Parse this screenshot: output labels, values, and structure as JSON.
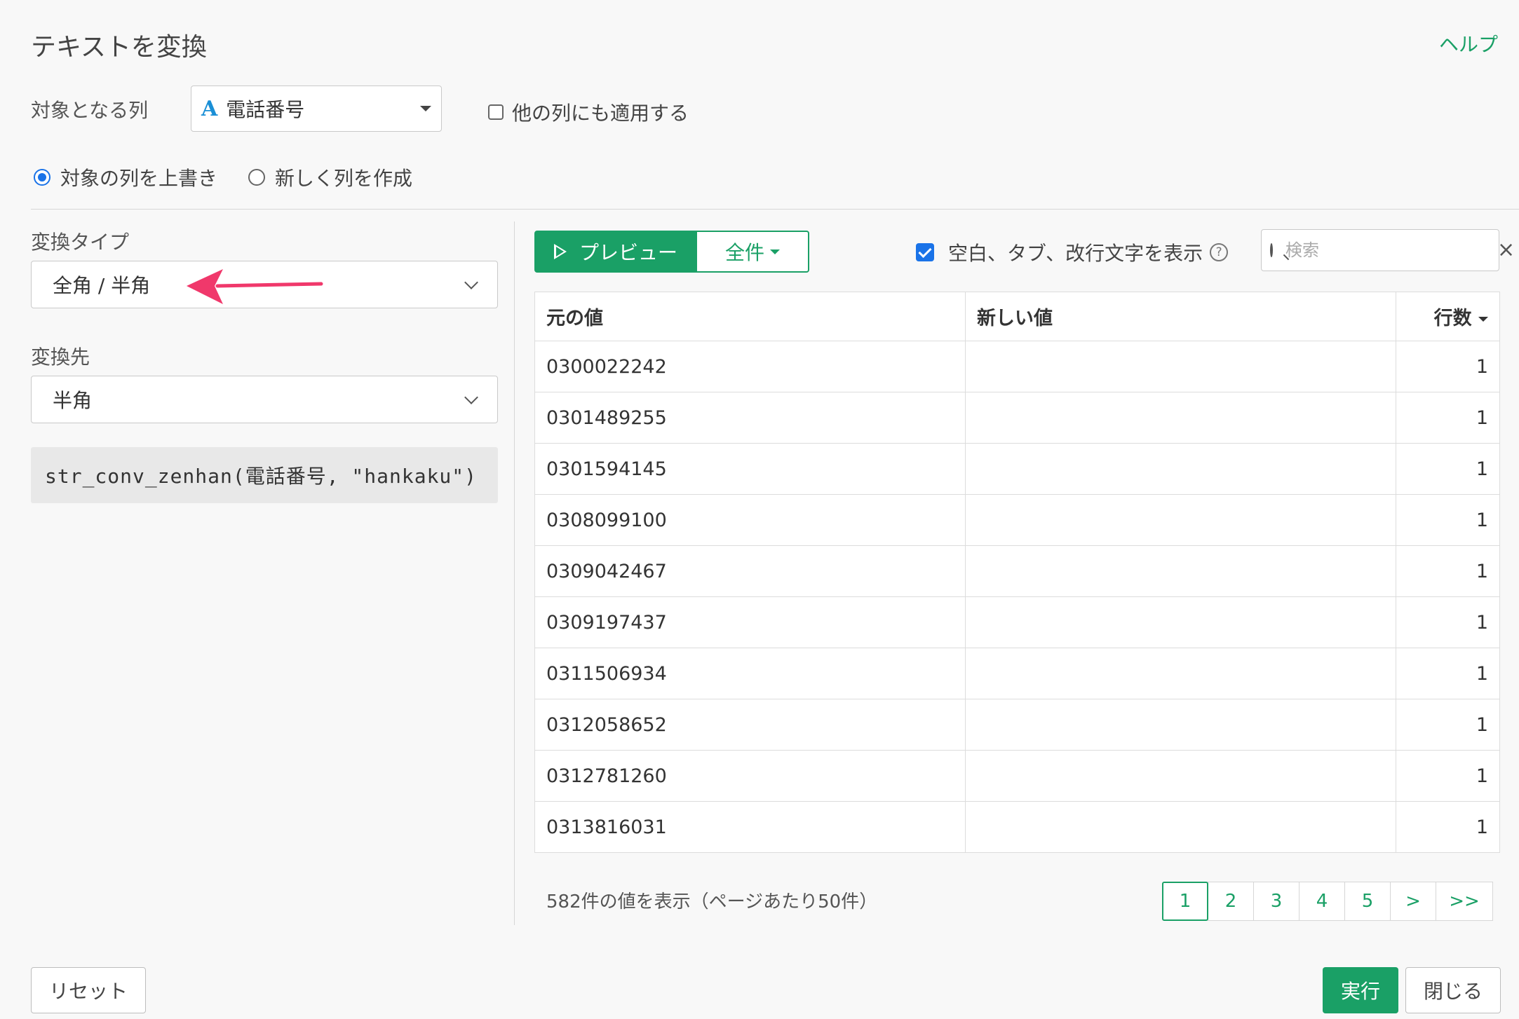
{
  "dialog": {
    "title": "テキストを変換",
    "help_label": "ヘルプ"
  },
  "target": {
    "label": "対象となる列",
    "column_type_icon": "A",
    "column_value": "電話番号",
    "apply_other_label": "他の列にも適用する",
    "apply_other_checked": false
  },
  "output_mode": {
    "overwrite_label": "対象の列を上書き",
    "new_column_label": "新しく列を作成",
    "selected": "overwrite"
  },
  "conversion": {
    "type_label": "変換タイプ",
    "type_value": "全角 / 半角",
    "dest_label": "変換先",
    "dest_value": "半角",
    "code": "str_conv_zenhan(電話番号, \"hankaku\")"
  },
  "preview": {
    "preview_button": "プレビュー",
    "all_button": "全件",
    "show_ws_label": "空白、タブ、改行文字を表示",
    "show_ws_checked": true,
    "search_placeholder": "検索"
  },
  "table": {
    "headers": [
      "元の値",
      "新しい値",
      "行数"
    ],
    "rows": [
      [
        "0300022242",
        "",
        "1"
      ],
      [
        "0301489255",
        "",
        "1"
      ],
      [
        "0301594145",
        "",
        "1"
      ],
      [
        "0308099100",
        "",
        "1"
      ],
      [
        "0309042467",
        "",
        "1"
      ],
      [
        "0309197437",
        "",
        "1"
      ],
      [
        "0311506934",
        "",
        "1"
      ],
      [
        "0312058652",
        "",
        "1"
      ],
      [
        "0312781260",
        "",
        "1"
      ],
      [
        "0313816031",
        "",
        "1"
      ]
    ]
  },
  "footer": {
    "summary": "582件の値を表示（ページあたり50件）",
    "pages": [
      "1",
      "2",
      "3",
      "4",
      "5",
      ">",
      ">>"
    ],
    "active_page": "1"
  },
  "buttons": {
    "reset": "リセット",
    "run": "実行",
    "close": "閉じる"
  },
  "colors": {
    "accent_green": "#1aa066",
    "checkbox_blue": "#1a73e8",
    "annotation_arrow": "#f0386b"
  }
}
